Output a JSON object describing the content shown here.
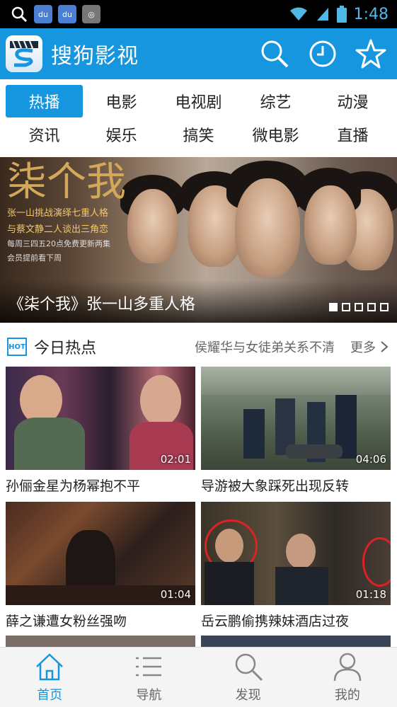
{
  "statusbar": {
    "icons": [
      "search-icon",
      "baidu-icon",
      "baidu-icon",
      "app-icon"
    ],
    "time": "1:48"
  },
  "appbar": {
    "title": "搜狗影视",
    "actions": [
      "search-icon",
      "history-icon",
      "favorite-icon"
    ]
  },
  "categories": [
    "热播",
    "电影",
    "电视剧",
    "综艺",
    "动漫",
    "资讯",
    "娱乐",
    "搞笑",
    "微电影",
    "直播"
  ],
  "banner": {
    "poster_title": "柒个我",
    "poster_line1": "张一山挑战演绎七重人格",
    "poster_line2": "与蔡文静二人谈出三角恋",
    "poster_small1": "每周三四五20点免费更新两集",
    "poster_small2": "会员提前看下周",
    "caption": "《柒个我》张一山多重人格",
    "pages": 5,
    "current_page": 1
  },
  "hot": {
    "badge": "HOT",
    "title": "今日热点",
    "headline": "侯耀华与女徒弟关系不清",
    "more": "更多"
  },
  "videos": [
    {
      "title": "孙俪金星为杨幂抱不平",
      "duration": "02:01"
    },
    {
      "title": "导游被大象踩死出现反转",
      "duration": "04:06"
    },
    {
      "title": "薛之谦遭女粉丝强吻",
      "duration": "01:04"
    },
    {
      "title": "岳云鹏偷携辣妹酒店过夜",
      "duration": "01:18"
    }
  ],
  "bottomnav": [
    {
      "label": "首页",
      "icon": "home-icon",
      "active": true
    },
    {
      "label": "导航",
      "icon": "list-icon",
      "active": false
    },
    {
      "label": "发现",
      "icon": "search-icon",
      "active": false
    },
    {
      "label": "我的",
      "icon": "user-icon",
      "active": false
    }
  ],
  "colors": {
    "accent": "#1596de"
  }
}
